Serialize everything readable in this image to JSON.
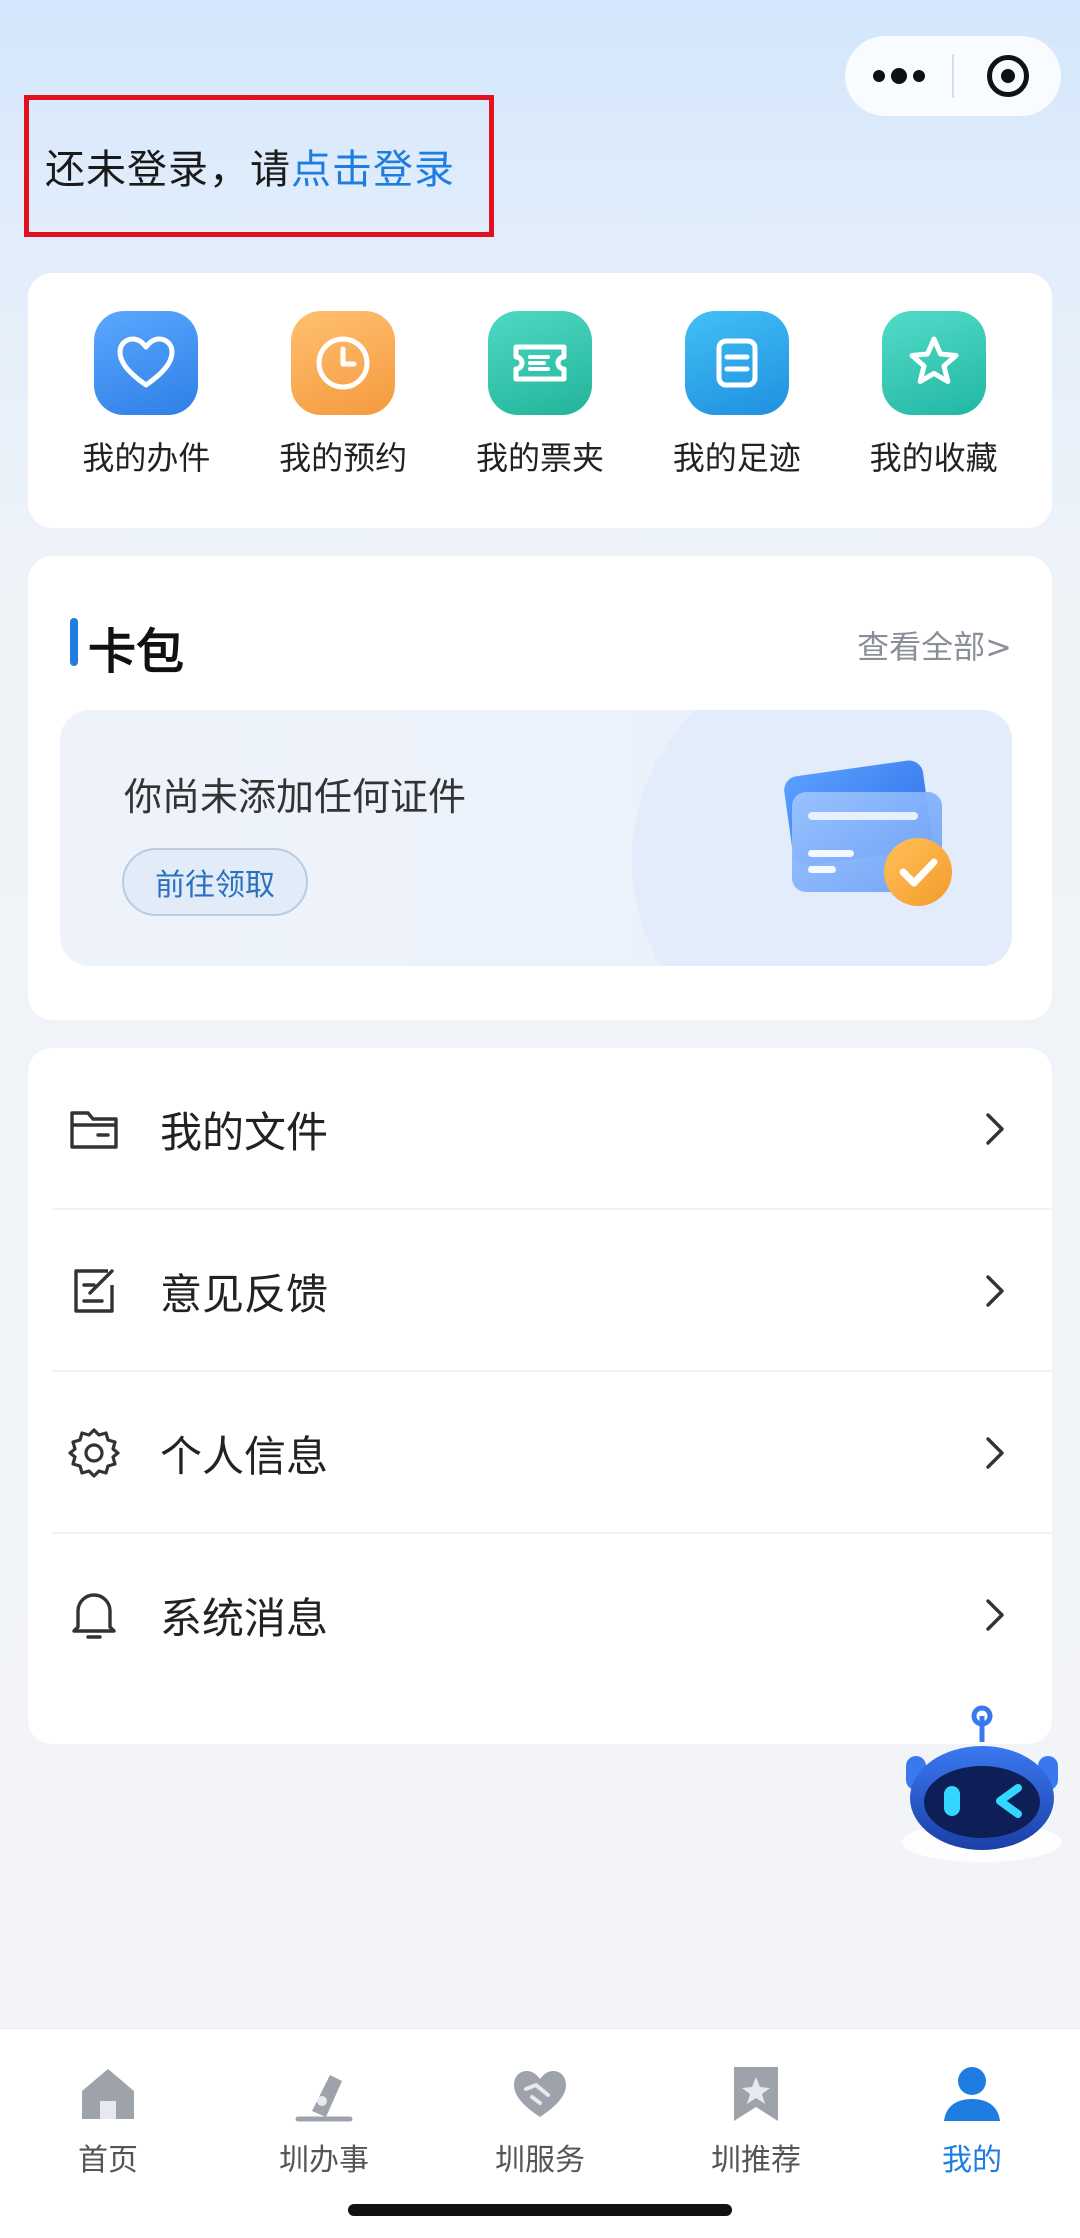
{
  "header": {
    "login_prompt": "还未登录，请",
    "login_link": "点击登录"
  },
  "quick_actions": [
    {
      "label": "我的办件",
      "icon": "heart-icon",
      "color": "#3d8ff0"
    },
    {
      "label": "我的预约",
      "icon": "clock-icon",
      "color": "#f7a54a"
    },
    {
      "label": "我的票夹",
      "icon": "ticket-icon",
      "color": "#2cc0a8"
    },
    {
      "label": "我的足迹",
      "icon": "footprint-doc-icon",
      "color": "#2aa6e8"
    },
    {
      "label": "我的收藏",
      "icon": "star-icon",
      "color": "#2ec6b0"
    }
  ],
  "wallet": {
    "title": "卡包",
    "view_all": "查看全部>",
    "empty_text": "你尚未添加任何证件",
    "go_button": "前往领取"
  },
  "menu": [
    {
      "label": "我的文件",
      "icon": "folder-icon"
    },
    {
      "label": "意见反馈",
      "icon": "feedback-edit-icon"
    },
    {
      "label": "个人信息",
      "icon": "gear-icon"
    },
    {
      "label": "系统消息",
      "icon": "bell-icon"
    }
  ],
  "tabbar": [
    {
      "label": "首页",
      "icon": "home-icon",
      "active": false
    },
    {
      "label": "圳办事",
      "icon": "pen-icon",
      "active": false
    },
    {
      "label": "圳服务",
      "icon": "handshake-icon",
      "active": false
    },
    {
      "label": "圳推荐",
      "icon": "bookmark-star-icon",
      "active": false
    },
    {
      "label": "我的",
      "icon": "user-icon",
      "active": true
    }
  ],
  "colors": {
    "accent": "#1f7ce0",
    "highlight_border": "#e3101e"
  }
}
